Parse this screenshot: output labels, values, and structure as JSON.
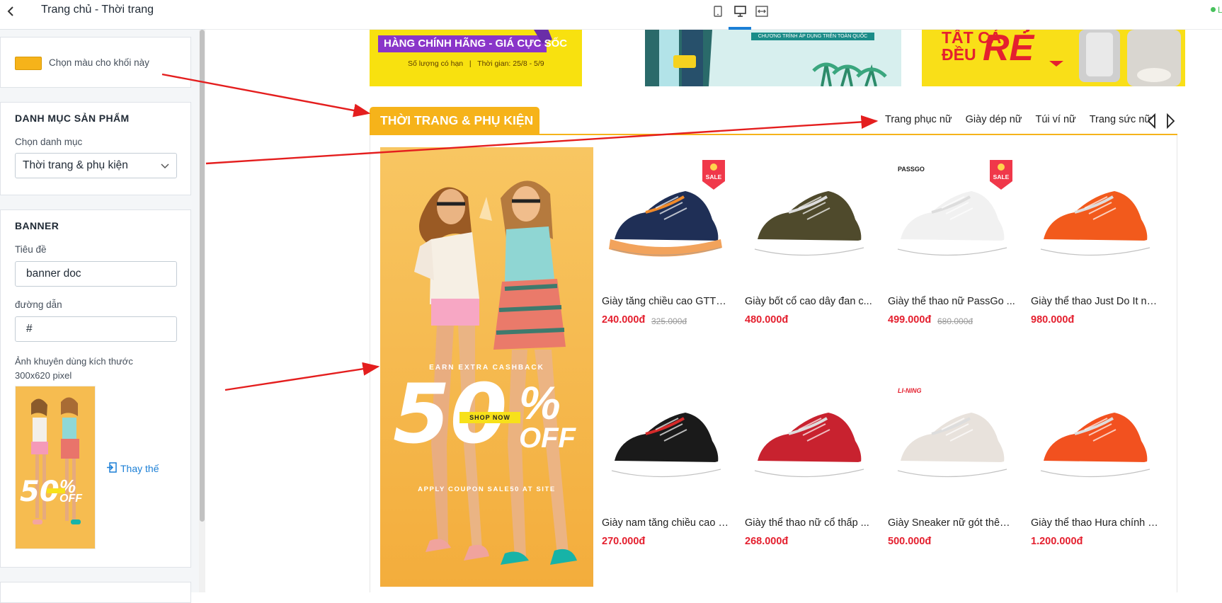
{
  "sidebar": {
    "title": "Trang chủ - Thời trang",
    "color_card": {
      "label": "Chọn màu cho khối này",
      "color": "#f6b31a"
    },
    "category_card": {
      "title": "DANH MỤC SẢN PHẨM",
      "select_label": "Chọn danh mục",
      "select_value": "Thời trang & phụ kiện"
    },
    "banner_card": {
      "title": "BANNER",
      "title_label": "Tiêu đề",
      "title_value": "banner doc",
      "link_label": "đường dẫn",
      "link_value": "#",
      "image_hint": "Ảnh khuyên dùng kích thước 300x620 pixel",
      "replace_label": "Thay thế"
    }
  },
  "topbar": {
    "devices": [
      "mobile-icon",
      "desktop-icon",
      "fullwidth-icon"
    ],
    "active_device": "desktop",
    "status": "L"
  },
  "promo": {
    "promo1": {
      "line1": "HÀNG CHÍNH HÃNG - GIÁ CỰC SỐC",
      "line2": "Số lượng có hạn   |   Thời gian: 25/8 - 5/9"
    },
    "promo2": {
      "text": "CHƯƠNG TRÌNH ÁP DỤNG TRÊN TOÀN QUỐC"
    },
    "promo3": {
      "line1": "TẤT CẢ",
      "line2": "ĐỀU",
      "big": "RẺ"
    }
  },
  "section": {
    "title": "THỜI TRANG & PHỤ KIỆN",
    "tabs": [
      "Trang phục nữ",
      "Giày dép nữ",
      "Túi ví nữ",
      "Trang sức nữ"
    ]
  },
  "vbanner": {
    "top_text": "EARN EXTRA CASHBACK",
    "big": "50",
    "percent": "%",
    "off": "OFF",
    "shop": "SHOP NOW",
    "bottom_text": "APPLY COUPON SALE50 AT SITE"
  },
  "products": [
    {
      "name": "Giày tăng chiều cao GTT2...",
      "price": "240.000đ",
      "old_price": "325.000đ",
      "sale": true,
      "brand": "",
      "color": "#1f2f56"
    },
    {
      "name": "Giày bốt cổ cao dây đan c...",
      "price": "480.000đ",
      "old_price": "",
      "sale": false,
      "brand": "",
      "color": "#4f4a2c"
    },
    {
      "name": "Giày thể thao nữ PassGo ...",
      "price": "499.000đ",
      "old_price": "680.000đ",
      "sale": true,
      "brand": "PASSGO",
      "color": "#f1f1f1"
    },
    {
      "name": "Giày thể thao Just Do It na...",
      "price": "980.000đ",
      "old_price": "",
      "sale": false,
      "brand": "",
      "color": "#f25a1c"
    },
    {
      "name": "Giày nam tăng chiều cao 8...",
      "price": "270.000đ",
      "old_price": "",
      "sale": false,
      "brand": "",
      "color": "#1a1a1a"
    },
    {
      "name": "Giày thể thao nữ cổ thấp ...",
      "price": "268.000đ",
      "old_price": "",
      "sale": false,
      "brand": "",
      "color": "#c8222f"
    },
    {
      "name": "Giày Sneaker nữ gót thêu ...",
      "price": "500.000đ",
      "old_price": "",
      "sale": false,
      "brand": "LI-NING",
      "color": "#e8e2dc"
    },
    {
      "name": "Giày thể thao Hura chính h...",
      "price": "1.200.000đ",
      "old_price": "",
      "sale": false,
      "brand": "",
      "color": "#f2511f"
    }
  ],
  "sale_badge_text": "SALE"
}
